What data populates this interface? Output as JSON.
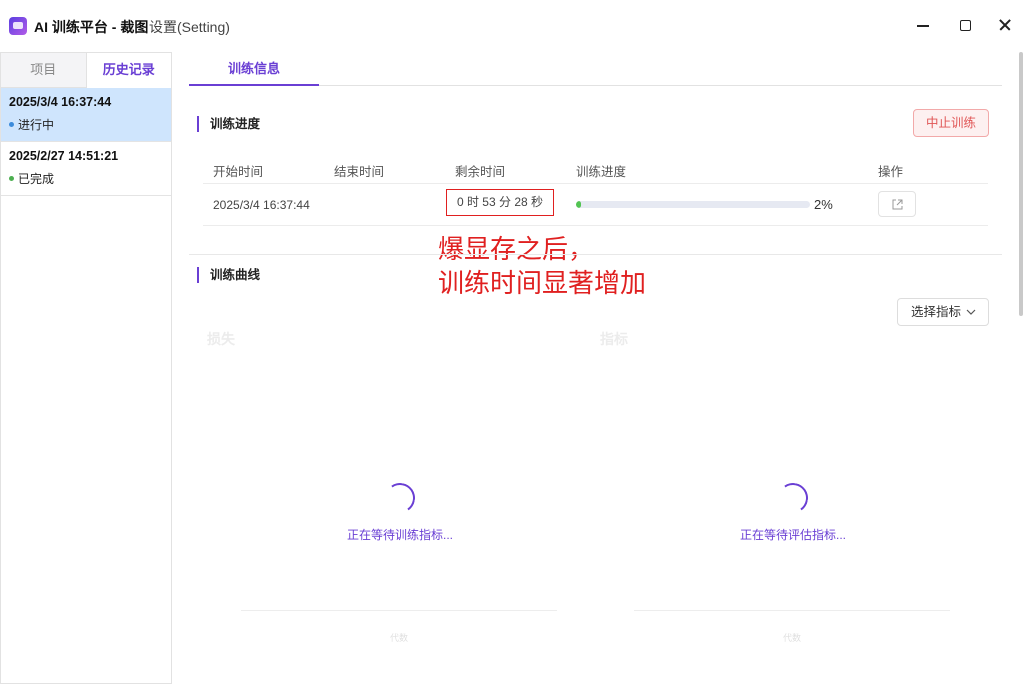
{
  "window": {
    "title": "AI 训练平台 - 裁图",
    "menu_setting": "设置(Setting)"
  },
  "sidebar": {
    "tabs": [
      {
        "label": "项目",
        "active": false
      },
      {
        "label": "历史记录",
        "active": true
      }
    ],
    "history": [
      {
        "date": "2025/3/4 16:37:44",
        "status": "进行中",
        "status_color": "#3b8bdb",
        "selected": true
      },
      {
        "date": "2025/2/27 14:51:21",
        "status": "已完成",
        "status_color": "#4caf50",
        "selected": false
      }
    ]
  },
  "main": {
    "tab_label": "训练信息",
    "progress_section": {
      "title": "训练进度",
      "stop_button": "中止训练",
      "headers": {
        "start": "开始时间",
        "end": "结束时间",
        "remaining": "剩余时间",
        "progress": "训练进度",
        "action": "操作"
      },
      "row": {
        "start": "2025/3/4 16:37:44",
        "end": "",
        "remaining": "0 时 53 分 28 秒",
        "progress_percent": 2,
        "progress_text": "2%"
      }
    },
    "annotation": {
      "line1": "爆显存之后，",
      "line2": "训练时间显著增加"
    },
    "curve_section": {
      "title": "训练曲线",
      "select_metric": "选择指标",
      "charts": [
        {
          "title": "损失",
          "loading_text": "正在等待训练指标...",
          "x_label": "代数"
        },
        {
          "title": "指标",
          "loading_text": "正在等待评估指标...",
          "x_label": "代数"
        }
      ]
    }
  },
  "colors": {
    "accent": "#6a3fd4",
    "danger": "#e05555",
    "progress": "#52c452",
    "selected_bg": "#cfe5fd"
  }
}
